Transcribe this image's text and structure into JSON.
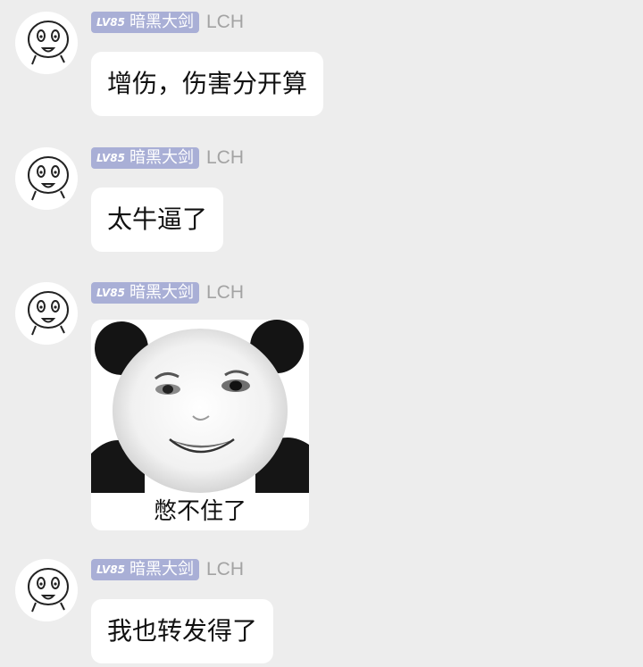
{
  "messages": [
    {
      "sender": {
        "level": "LV85",
        "title": "暗黑大剑",
        "nickname": "LCH"
      },
      "text": "增伤，伤害分开算"
    },
    {
      "sender": {
        "level": "LV85",
        "title": "暗黑大剑",
        "nickname": "LCH"
      },
      "text": "太牛逼了"
    },
    {
      "sender": {
        "level": "LV85",
        "title": "暗黑大剑",
        "nickname": "LCH"
      },
      "sticker": {
        "caption": "憋不住了",
        "icon": "panda-face-meme-sticker"
      }
    },
    {
      "sender": {
        "level": "LV85",
        "title": "暗黑大剑",
        "nickname": "LCH"
      },
      "text": "我也转发得了"
    }
  ],
  "colors": {
    "background": "#ededed",
    "bubble": "#ffffff",
    "badge": "#a9afd6",
    "nickname": "#a3a3a3"
  }
}
